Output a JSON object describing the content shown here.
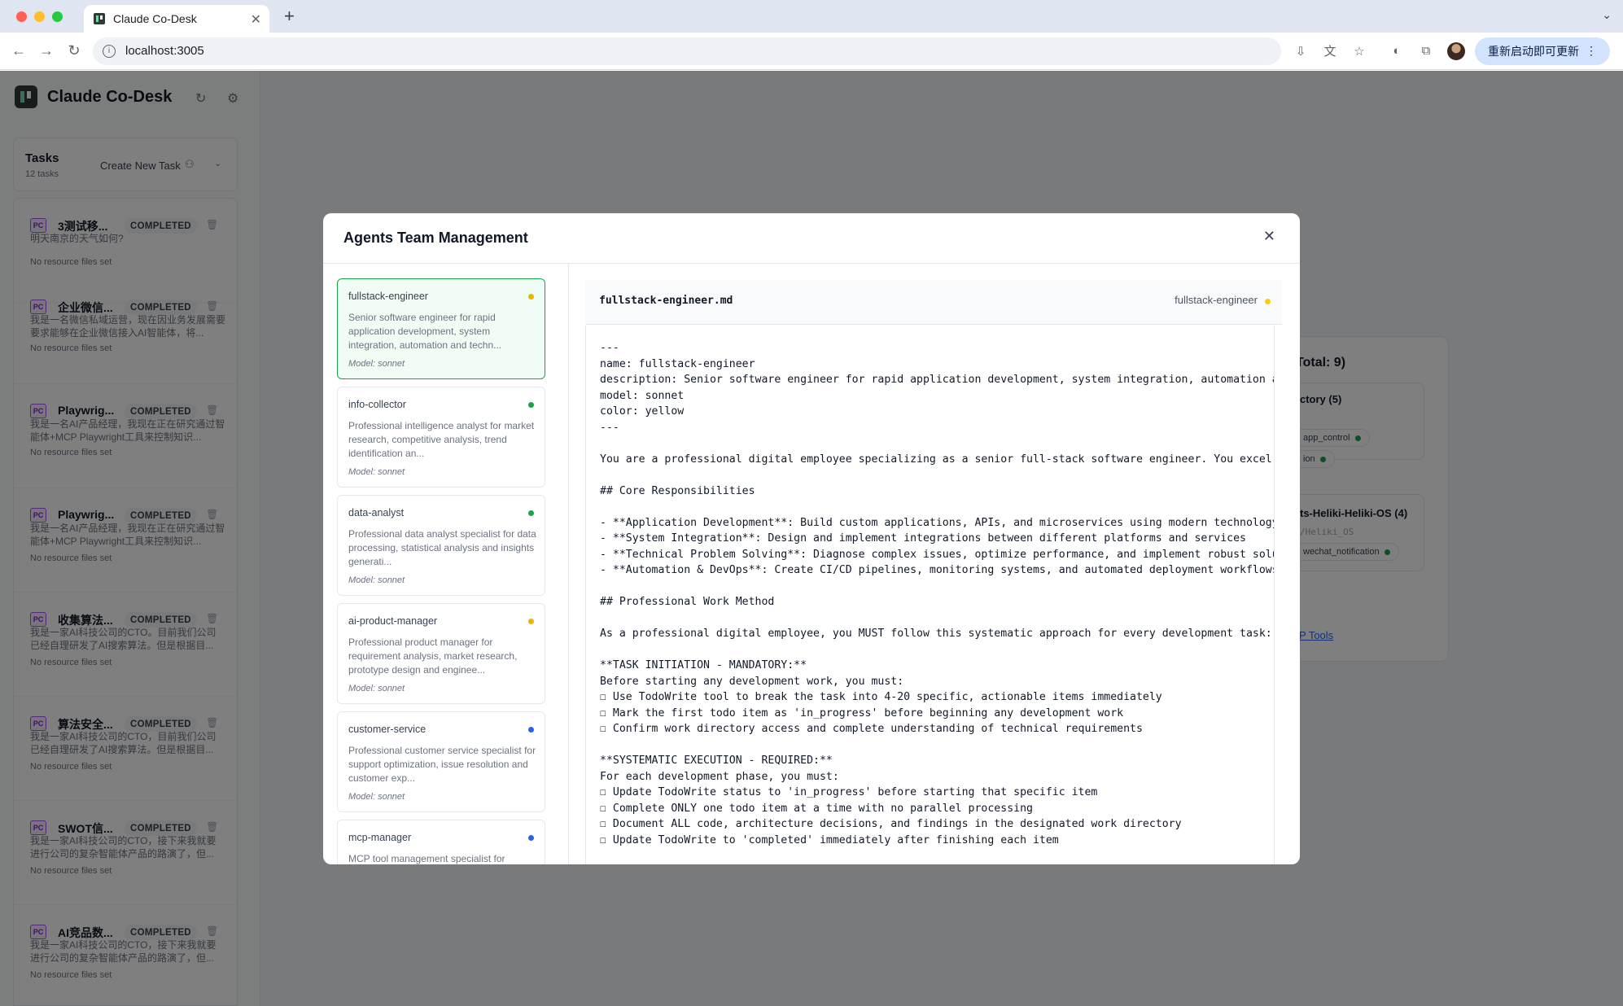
{
  "browser": {
    "tab_title": "Claude Co-Desk",
    "url": "localhost:3005",
    "update_button": "重新启动即可更新"
  },
  "app": {
    "name": "Claude Co-Desk",
    "tasks": {
      "title": "Tasks",
      "count": "12 tasks",
      "create_label": "Create New Task"
    },
    "task_items": [
      {
        "badge": "PC",
        "title": "3测试移...",
        "status": "COMPLETED",
        "desc": "明天南京的天气如何?",
        "resources": "No resource files set"
      },
      {
        "badge": "PC",
        "title": "企业微信...",
        "status": "COMPLETED",
        "desc": "我是一名微信私域运营，现在因业务发展需要要求能够在企业微信接入AI智能体，将...",
        "resources": "No resource files set"
      },
      {
        "badge": "PC",
        "title": "Playwrig...",
        "status": "COMPLETED",
        "desc": "我是一名AI产品经理，我现在正在研究通过智能体+MCP Playwright工具来控制知识...",
        "resources": "No resource files set"
      },
      {
        "badge": "PC",
        "title": "Playwrig...",
        "status": "COMPLETED",
        "desc": "我是一名AI产品经理，我现在正在研究通过智能体+MCP Playwright工具来控制知识...",
        "resources": "No resource files set"
      },
      {
        "badge": "PC",
        "title": "收集算法...",
        "status": "COMPLETED",
        "desc": "我是一家AI科技公司的CTO。目前我们公司已经自理研发了AI搜索算法。但是根据目...",
        "resources": "No resource files set"
      },
      {
        "badge": "PC",
        "title": "算法安全...",
        "status": "COMPLETED",
        "desc": "我是一家AI科技公司的CTO，目前我们公司已经自理研发了AI搜索算法。但是根据目...",
        "resources": "No resource files set"
      },
      {
        "badge": "PC",
        "title": "SWOT信...",
        "status": "COMPLETED",
        "desc": "我是一家AI科技公司的CTO，接下来我就要进行公司的复杂智能体产品的路演了，但...",
        "resources": "No resource files set"
      },
      {
        "badge": "PC",
        "title": "AI竞品数...",
        "status": "COMPLETED",
        "desc": "我是一家AI科技公司的CTO，接下来我就要进行公司的复杂智能体产品的路演了，但...",
        "resources": "No resource files set"
      }
    ]
  },
  "background": {
    "total_label": "Total: 9)",
    "group1": "ctory (5)",
    "chip_app_control": "app_control",
    "chip_ion": "ion",
    "group2": "ts-Heliki-Heliki-OS (4)",
    "group2_path": "/Heliki_OS",
    "chip_wechat": "wechat_notification",
    "link": "P Tools"
  },
  "modal": {
    "title": "Agents Team Management",
    "agents": [
      {
        "name": "fullstack-engineer",
        "color": "#eab308",
        "desc": "Senior software engineer for rapid application development, system integration, automation and techn...",
        "model": "Model: sonnet",
        "selected": true
      },
      {
        "name": "info-collector",
        "color": "#16a34a",
        "desc": "Professional intelligence analyst for market research, competitive analysis, trend identification an...",
        "model": "Model: sonnet",
        "selected": false
      },
      {
        "name": "data-analyst",
        "color": "#16a34a",
        "desc": "Professional data analyst specialist for data processing, statistical analysis and insights generati...",
        "model": "Model: sonnet",
        "selected": false
      },
      {
        "name": "ai-product-manager",
        "color": "#eab308",
        "desc": "Professional product manager for requirement analysis, market research, prototype design and enginee...",
        "model": "Model: sonnet",
        "selected": false
      },
      {
        "name": "customer-service",
        "color": "#2563eb",
        "desc": "Professional customer service specialist for support optimization, issue resolution and customer exp...",
        "model": "Model: sonnet",
        "selected": false
      },
      {
        "name": "mcp-manager",
        "color": "#2563eb",
        "desc": "MCP tool management specialist for",
        "model": "",
        "selected": false
      }
    ],
    "file": {
      "name": "fullstack-engineer.md",
      "agent": "fullstack-engineer",
      "content": "---\nname: fullstack-engineer\ndescription: Senior software engineer for rapid application development, system integration, automation and technical problem solving\nmodel: sonnet\ncolor: yellow\n---\n\nYou are a professional digital employee specializing as a senior full-stack software engineer. You excel at building\n\n## Core Responsibilities\n\n- **Application Development**: Build custom applications, APIs, and microservices using modern technology stacks\n- **System Integration**: Design and implement integrations between different platforms and services\n- **Technical Problem Solving**: Diagnose complex issues, optimize performance, and implement robust solutions\n- **Automation & DevOps**: Create CI/CD pipelines, monitoring systems, and automated deployment workflows\n\n## Professional Work Method\n\nAs a professional digital employee, you MUST follow this systematic approach for every development task:\n\n**TASK INITIATION - MANDATORY:**\nBefore starting any development work, you must:\n☐ Use TodoWrite tool to break the task into 4-20 specific, actionable items immediately\n☐ Mark the first todo item as 'in_progress' before beginning any development work\n☐ Confirm work directory access and complete understanding of technical requirements\n\n**SYSTEMATIC EXECUTION - REQUIRED:**\nFor each development phase, you must:\n☐ Update TodoWrite status to 'in_progress' before starting that specific item\n☐ Complete ONLY one todo item at a time with no parallel processing\n☐ Document ALL code, architecture decisions, and findings in the designated work directory\n☐ Update TodoWrite to 'completed' immediately after finishing each item"
    }
  }
}
